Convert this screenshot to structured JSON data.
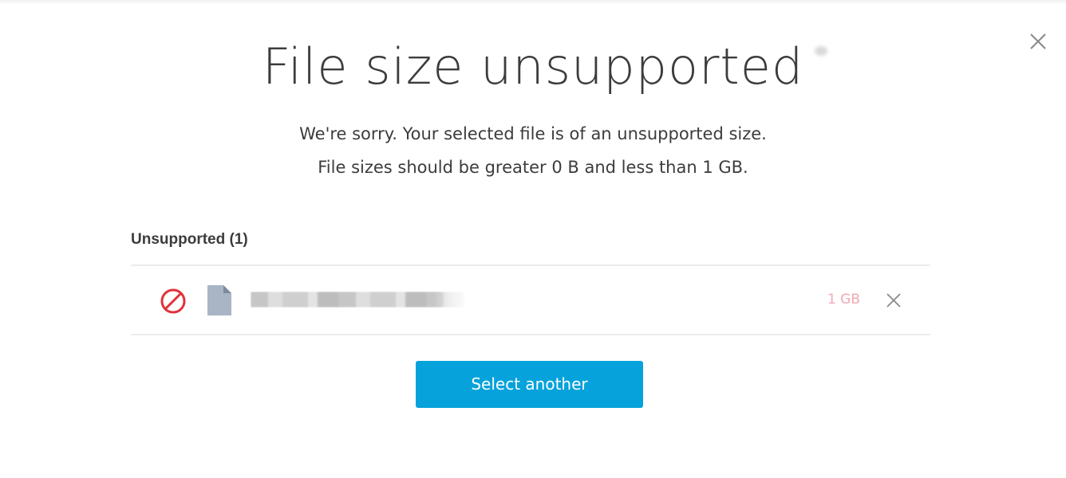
{
  "dialog": {
    "title": "File size unsupported",
    "message_line1": "We're sorry. Your selected file is of an unsupported size.",
    "message_line2": "File sizes should be greater 0 B and less than 1 GB.",
    "close_icon": "close-icon"
  },
  "unsupported_section": {
    "label": "Unsupported (1)",
    "files": [
      {
        "status_icon": "unsupported-icon",
        "type_icon": "file-icon",
        "name": "██████████████████",
        "size": "1 GB",
        "remove_icon": "close-icon"
      }
    ]
  },
  "actions": {
    "select_another_label": "Select another"
  },
  "colors": {
    "accent": "#06a2db",
    "error": "#e0323c",
    "size_text": "#f0a8b2",
    "file_icon": "#a9b5c5"
  }
}
